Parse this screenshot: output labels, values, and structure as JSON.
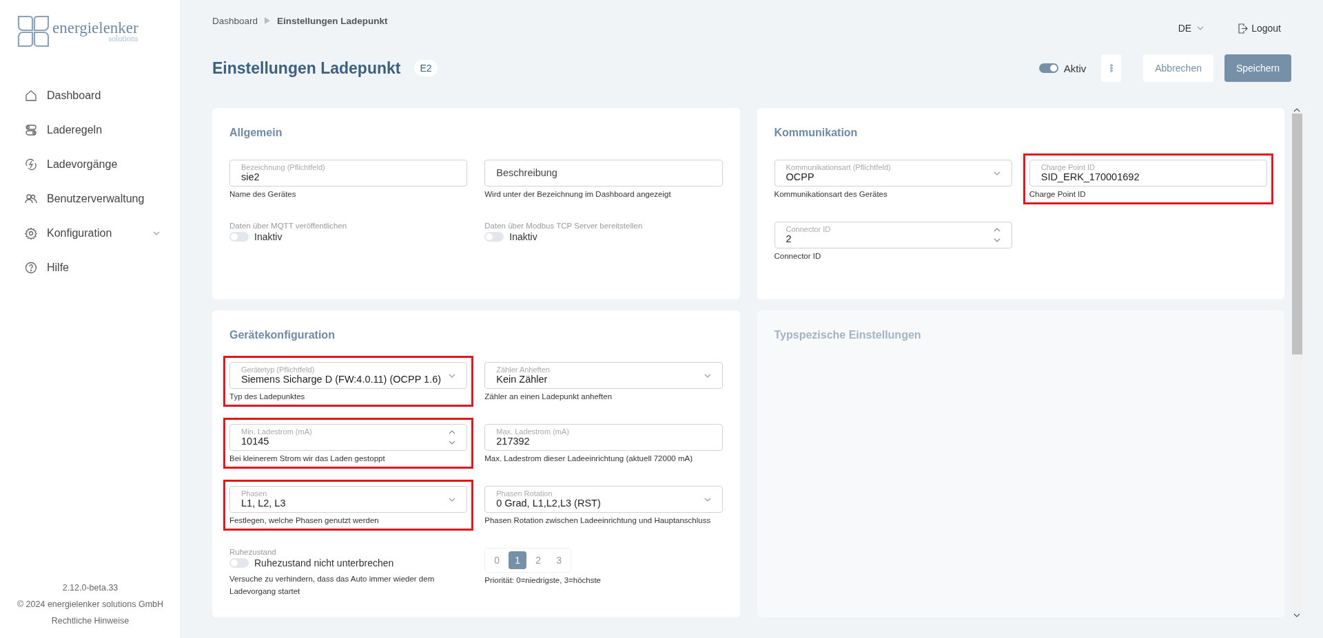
{
  "sidebar": {
    "logo": {
      "name": "energielenker",
      "sub": "solutions"
    },
    "nav": [
      {
        "label": "Dashboard",
        "expandable": false,
        "selected": false
      },
      {
        "label": "Laderegeln",
        "expandable": false,
        "selected": false
      },
      {
        "label": "Ladevorgänge",
        "expandable": false,
        "selected": false
      },
      {
        "label": "Benutzerverwaltung",
        "expandable": false,
        "selected": false
      },
      {
        "label": "Konfiguration",
        "expandable": true,
        "selected": false
      },
      {
        "label": "Hilfe",
        "expandable": false,
        "selected": false
      }
    ],
    "footer": {
      "version": "2.12.0-beta.33",
      "copyright": "© 2024 energielenker solutions GmbH",
      "legal_link": "Rechtliche Hinweise"
    }
  },
  "header": {
    "breadcrumb": [
      "Dashboard",
      "Einstellungen Ladepunkt"
    ],
    "language": "DE",
    "logout": "Logout",
    "title": "Einstellungen Ladepunkt",
    "badge": "E2",
    "active_toggle": {
      "label": "Aktiv",
      "on": true
    },
    "buttons": [
      {
        "label": "Abbrechen",
        "kind": "secondary"
      },
      {
        "label": "Speichern",
        "kind": "primary"
      }
    ]
  },
  "cards": [
    {
      "title": "Allgemein",
      "disabled": false,
      "fields": [
        {
          "kind": "text",
          "label": "Bezeichnung (Pflichtfeld)",
          "value": "sie2",
          "hint": "Name des Gerätes"
        },
        {
          "kind": "text",
          "placeholder": "Beschreibung",
          "hint": "Wird unter der Bezeichnung im Dashboard angezeigt"
        },
        {
          "kind": "toggle",
          "label": "Daten über MQTT veröffentlichen",
          "on": false,
          "text": "Inaktiv"
        },
        {
          "kind": "toggle",
          "label": "Daten über Modbus TCP Server bereitstellen",
          "on": false,
          "text": "Inaktiv"
        }
      ]
    },
    {
      "title": "Kommunikation",
      "disabled": false,
      "fields": [
        {
          "kind": "select",
          "label": "Kommunikationsart (Pflichtfeld)",
          "value": "OCPP",
          "hint": "Kommunikationsart des Gerätes"
        },
        {
          "kind": "text",
          "label": "Charge Point ID",
          "value": "SID_ERK_170001692",
          "hint": "Charge Point ID",
          "highlighted": true
        },
        {
          "kind": "number",
          "label": "Connector ID",
          "value": "2",
          "hint": "Connector ID"
        }
      ]
    },
    {
      "title": "Gerätekonfiguration",
      "disabled": false,
      "fields": [
        {
          "kind": "select",
          "label": "Gerätetyp (Pflichtfeld)",
          "value": "Siemens Sicharge D (FW:4.0.11) (OCPP 1.6)",
          "hint": "Typ des Ladepunktes",
          "highlighted": true
        },
        {
          "kind": "select",
          "label": "Zähler Anheften",
          "value": "Kein Zähler",
          "hint": "Zähler an einen Ladepunkt anheften"
        },
        {
          "kind": "number",
          "label": "Min. Ladestrom (mA)",
          "value": "10145",
          "hint": "Bei kleinerem Strom wir das Laden gestoppt",
          "highlighted": true
        },
        {
          "kind": "text",
          "label": "Max. Ladestrom (mA)",
          "value": "217392",
          "hint": "Max. Ladestrom dieser Ladeeinrichtung (aktuell 72000 mA)"
        },
        {
          "kind": "select",
          "label": "Phasen",
          "value": "L1, L2, L3",
          "hint": "Festlegen, welche Phasen genutzt werden",
          "highlighted": true
        },
        {
          "kind": "select",
          "label": "Phasen Rotation",
          "value": "0 Grad, L1,L2,L3 (RST)",
          "hint": "Phasen Rotation zwischen Ladeeinrichtung und Hauptanschluss"
        },
        {
          "kind": "toggle",
          "label": "Ruhezustand",
          "on": false,
          "text": "Ruhezustand nicht unterbrechen",
          "hint": "Versuche zu verhindern, dass das Auto immer wieder dem Ladevorgang startet"
        },
        {
          "kind": "segmented",
          "options": [
            {
              "label": "0",
              "selected": false
            },
            {
              "label": "1",
              "selected": true
            },
            {
              "label": "2",
              "selected": false
            },
            {
              "label": "3",
              "selected": false
            }
          ],
          "hint": "Priorität: 0=niedrigste, 3=höchste"
        }
      ]
    },
    {
      "title": "Typspezische Einstellungen",
      "disabled": true
    }
  ]
}
